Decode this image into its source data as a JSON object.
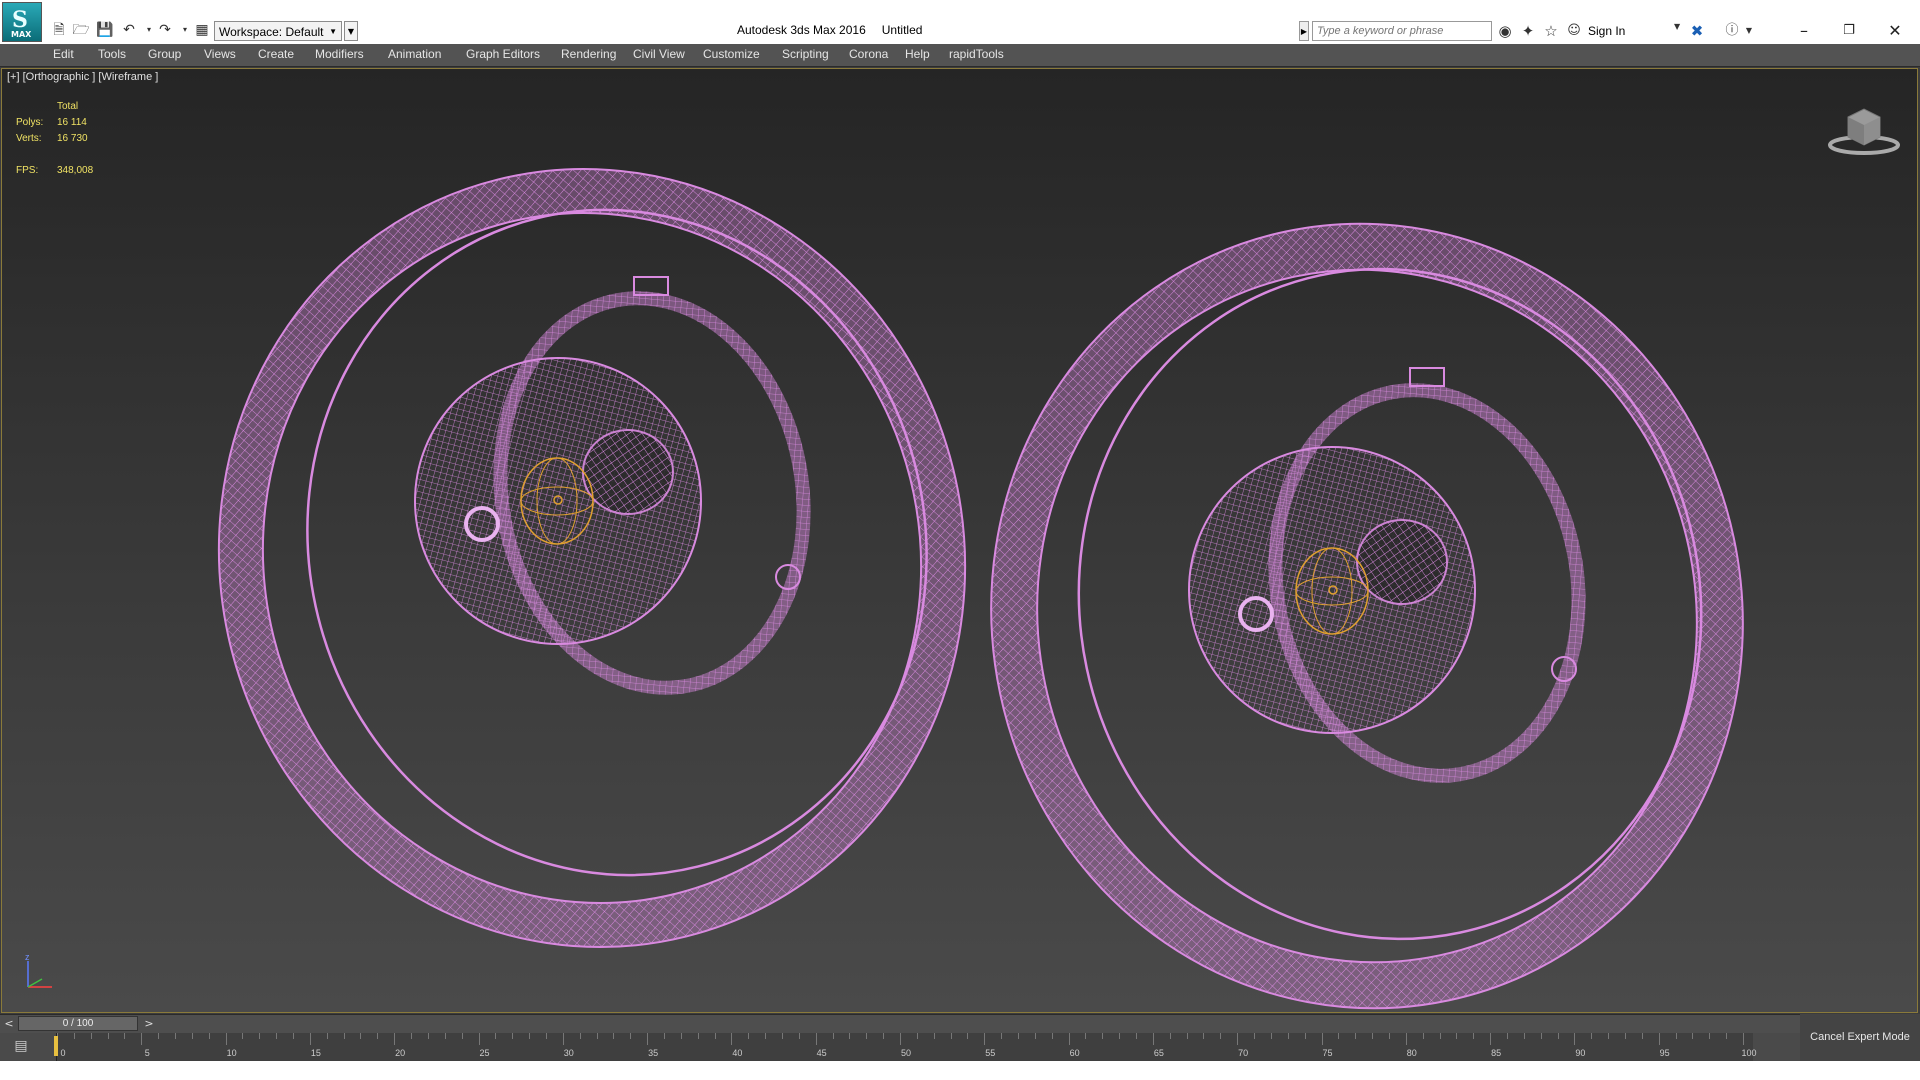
{
  "app": {
    "logo_text": "MAX",
    "title": "Autodesk 3ds Max 2016",
    "file": "Untitled",
    "workspace_label": "Workspace: Default"
  },
  "toolbar": {
    "search_placeholder": "Type a keyword or phrase",
    "signin_label": "Sign In"
  },
  "menu": {
    "items": [
      "Edit",
      "Tools",
      "Group",
      "Views",
      "Create",
      "Modifiers",
      "Animation",
      "Graph Editors",
      "Rendering",
      "Civil View",
      "Customize",
      "Scripting",
      "Corona",
      "Help",
      "rapidTools"
    ]
  },
  "viewport": {
    "label": "[+] [Orthographic ] [Wireframe ]",
    "stats": {
      "total_label": "Total",
      "polys_label": "Polys:",
      "polys_value": "16 114",
      "verts_label": "Verts:",
      "verts_value": "16 730",
      "fps_label": "FPS:",
      "fps_value": "348,008"
    },
    "wire_color": "#d98ae0",
    "selected_color": "#e0a030",
    "axis_label": "z"
  },
  "timeline": {
    "slider_text": "0 / 100",
    "current_frame": 0,
    "total_frames": 100,
    "labels": [
      "0",
      "5",
      "10",
      "15",
      "20",
      "25",
      "30",
      "35",
      "40",
      "45",
      "50",
      "55",
      "60",
      "65",
      "70",
      "75",
      "80",
      "85",
      "90",
      "95",
      "100"
    ]
  },
  "status": {
    "cancel_expert_label": "Cancel Expert Mode"
  }
}
